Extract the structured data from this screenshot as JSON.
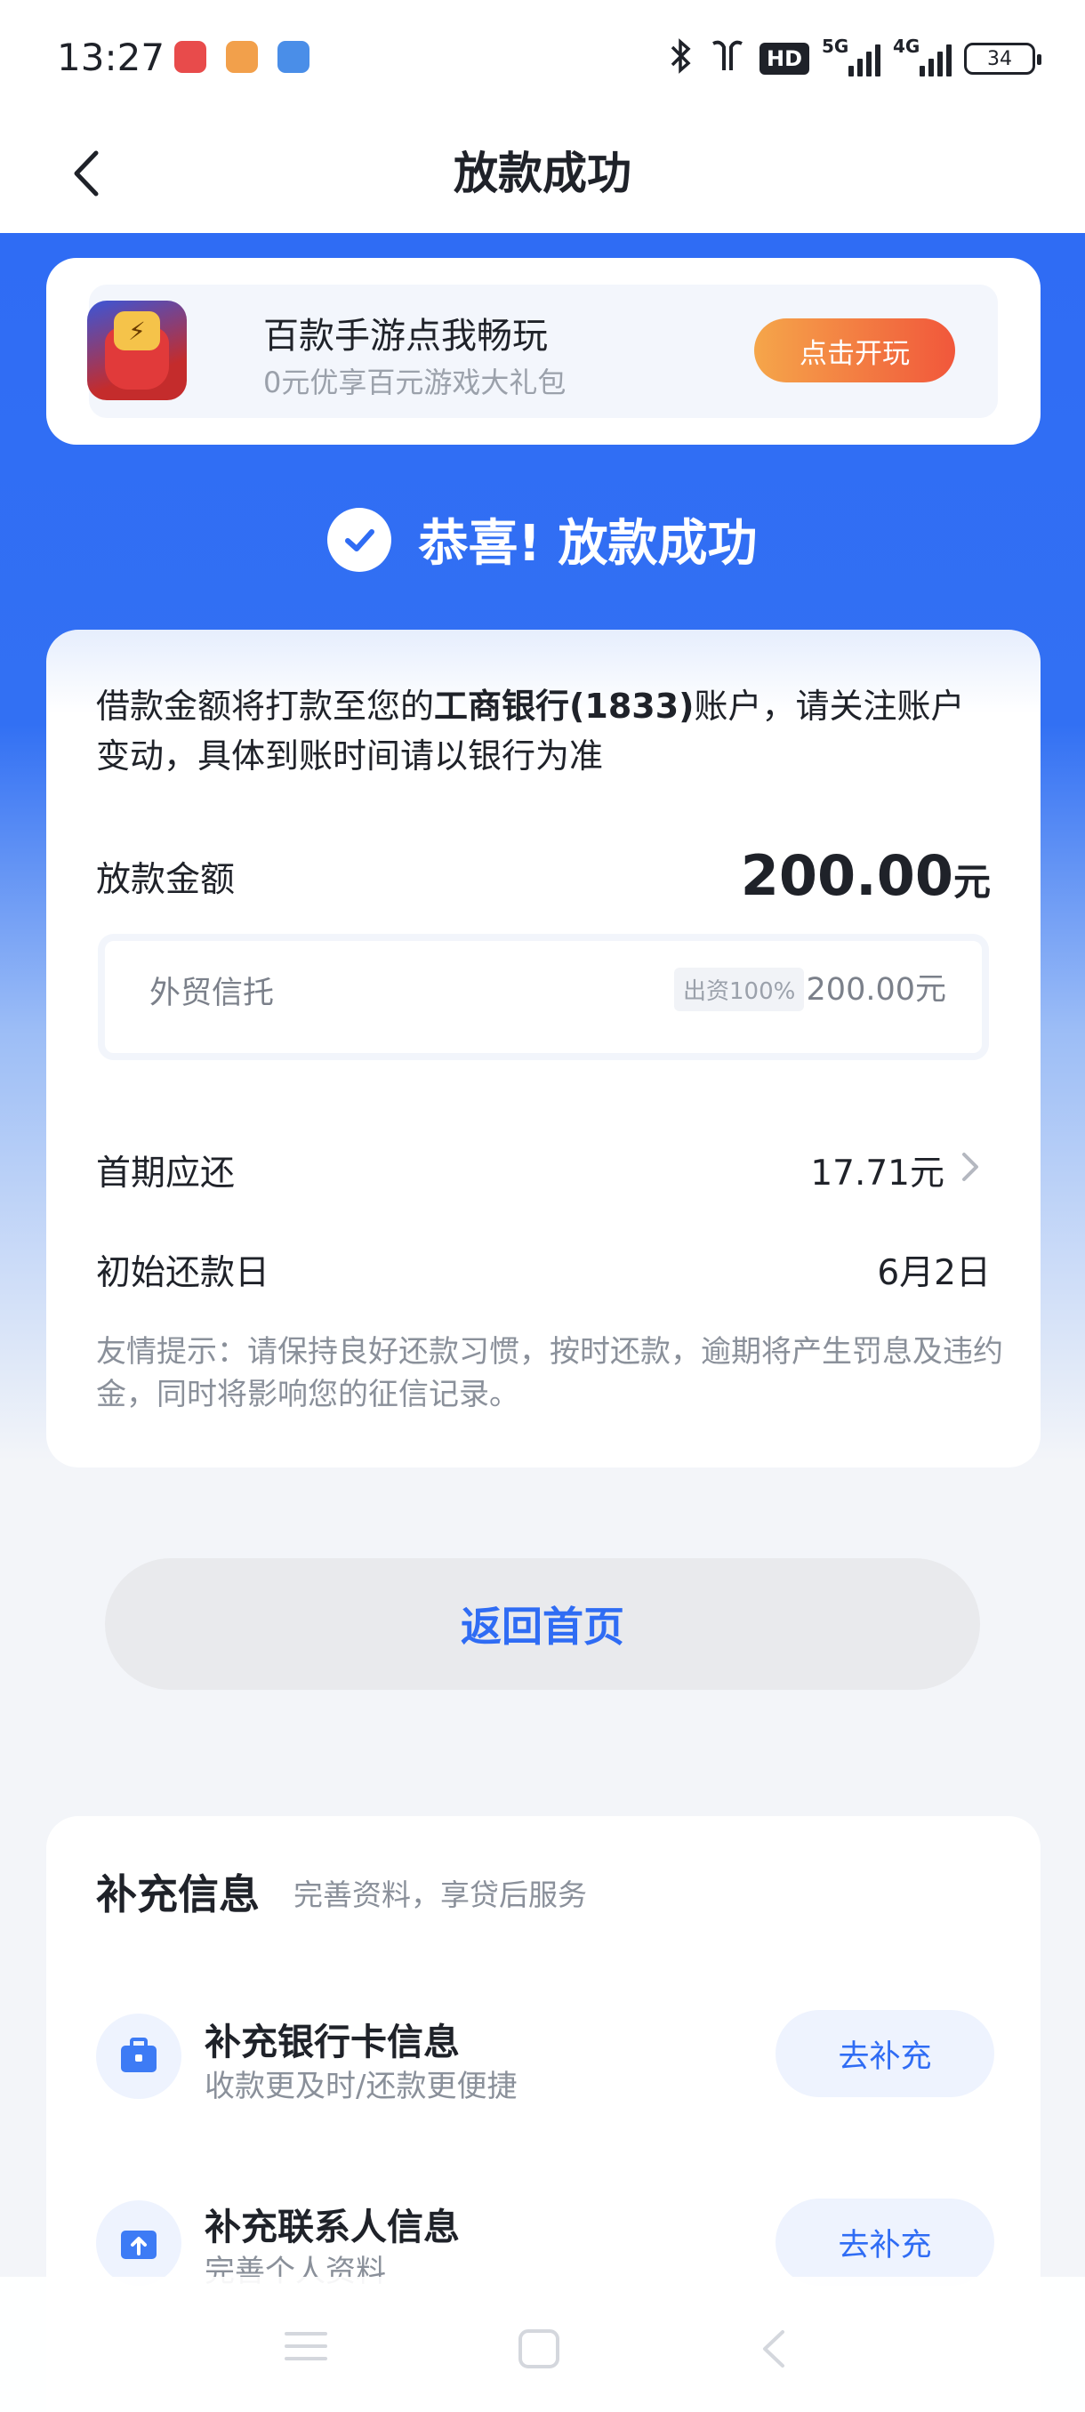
{
  "status_bar": {
    "time": "13:27",
    "network_1": "5G",
    "network_2": "4G",
    "hd_label": "HD",
    "battery": "34"
  },
  "nav": {
    "title": "放款成功"
  },
  "promo": {
    "title": "百款手游点我畅玩",
    "subtitle": "0元优享百元游戏大礼包",
    "button": "点击开玩"
  },
  "success": {
    "message": "恭喜! 放款成功"
  },
  "loan": {
    "notice_prefix": "借款金额将打款至您的",
    "bank": "工商银行(1833)",
    "notice_suffix": "账户，请关注账户变动，具体到账时间请以银行为准",
    "amount_label": "放款金额",
    "amount_value": "200.00",
    "amount_unit": "元",
    "funder_name": "外贸信托",
    "funder_badge": "出资100%",
    "funder_amount": "200.00元",
    "first_repay_label": "首期应还",
    "first_repay_value": "17.71元",
    "start_date_label": "初始还款日",
    "start_date_value": "6月2日",
    "tip": "友情提示：请保持良好还款习惯，按时还款，逾期将产生罚息及违约金，同时将影响您的征信记录。"
  },
  "actions": {
    "home_button": "返回首页"
  },
  "extra": {
    "title": "补充信息",
    "subtitle": "完善资料，享贷后服务",
    "items": [
      {
        "title": "补充银行卡信息",
        "subtitle": "收款更及时/还款更便捷",
        "button": "去补充",
        "icon": "briefcase-icon"
      },
      {
        "title": "补充联系人信息",
        "subtitle": "完善个人资料",
        "button": "去补充",
        "icon": "upload-folder-icon"
      }
    ]
  },
  "colors": {
    "brand_blue": "#2f6cf4",
    "promo_button_start": "#f5a64a",
    "promo_button_end": "#f1573b"
  }
}
